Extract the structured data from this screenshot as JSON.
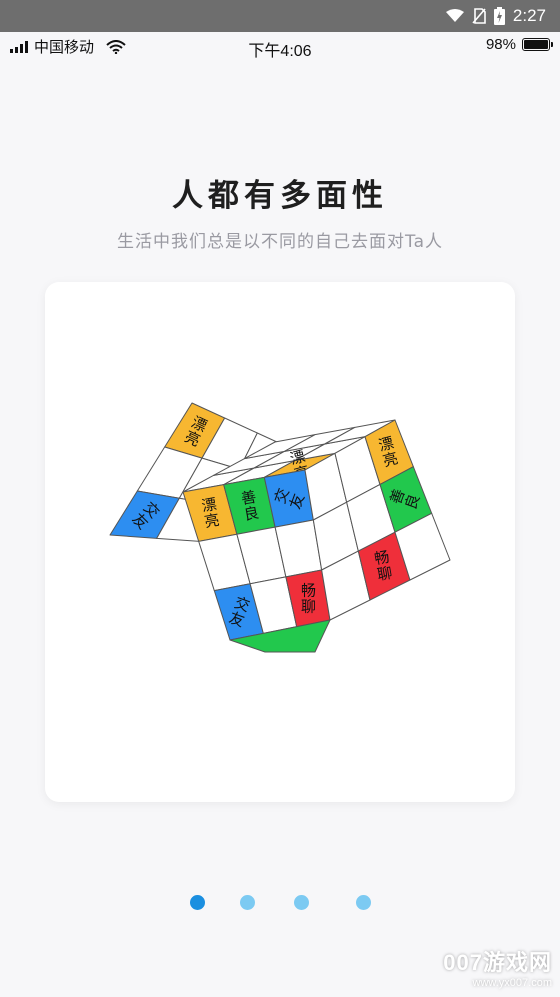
{
  "system_bar": {
    "time": "2:27",
    "wifi_icon": "wifi-icon",
    "no_sim_icon": "no-sim-icon",
    "battery_icon": "battery-charging-icon"
  },
  "status_bar": {
    "carrier": "中国移动",
    "time": "下午4:06",
    "battery_percent": "98%",
    "battery_level": 0.98
  },
  "onboarding": {
    "title": "人都有多面性",
    "subtitle": "生活中我们总是以不同的自己去面对Ta人",
    "pages_total": 4,
    "active_page": 1
  },
  "cube": {
    "colors": {
      "yellow": "#f7b731",
      "blue": "#2d8ef1",
      "green": "#22c84d",
      "red": "#ef2f3a",
      "white": "#ffffff"
    },
    "tiles": [
      {
        "label": "漂亮",
        "color": "yellow"
      },
      {
        "label": "交友",
        "color": "blue"
      },
      {
        "label": "漂亮",
        "color": "yellow"
      },
      {
        "label": "善良",
        "color": "green"
      },
      {
        "label": "交友",
        "color": "blue"
      },
      {
        "label": "漂亮",
        "color": "yellow"
      },
      {
        "label": "善良",
        "color": "green"
      },
      {
        "label": "畅聊",
        "color": "red"
      },
      {
        "label": "交友",
        "color": "blue"
      },
      {
        "label": "畅聊",
        "color": "red"
      },
      {
        "label": "畅聊",
        "color": "red"
      }
    ]
  },
  "colors": {
    "dot_active": "#1b8fe0",
    "dot_inactive": "#7ccaf2"
  },
  "watermark": {
    "brand": "007游戏网",
    "url": "www.yx007.com"
  }
}
